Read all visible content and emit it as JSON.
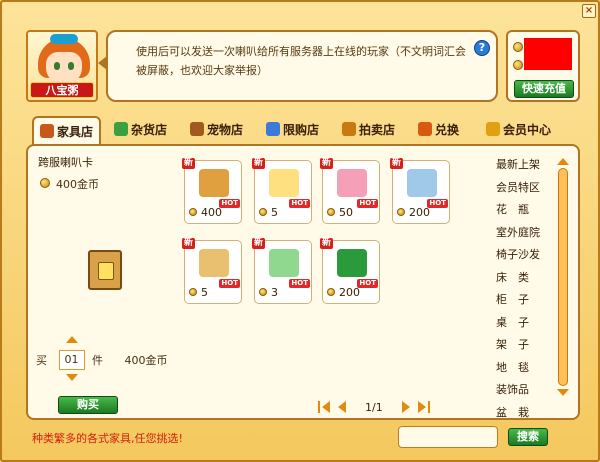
{
  "npc": {
    "name": "八宝粥",
    "message": "使用后可以发送一次喇叭给所有服务器上在线的玩家（不文明词汇会被屏蔽，也欢迎大家举报）"
  },
  "currency": {
    "recharge_label": "快速充值"
  },
  "tabs": [
    {
      "label": "家具店",
      "icon": "house-icon",
      "color": "#c8581a"
    },
    {
      "label": "杂货店",
      "icon": "clover-icon",
      "color": "#3aa040"
    },
    {
      "label": "宠物店",
      "icon": "pet-icon",
      "color": "#a05a20"
    },
    {
      "label": "限购店",
      "icon": "bottle-icon",
      "color": "#3a7ad8"
    },
    {
      "label": "拍卖店",
      "icon": "gavel-icon",
      "color": "#c87a10"
    },
    {
      "label": "兑换",
      "icon": "exchange-icon",
      "color": "#d85a10"
    },
    {
      "label": "会员中心",
      "icon": "crown-icon",
      "color": "#e0a010"
    }
  ],
  "selected_item": {
    "name": "跨服喇叭卡",
    "price": "400金币",
    "quantity_label": "买",
    "quantity": "01",
    "unit": "件",
    "total": "400金币",
    "buy_label": "购买"
  },
  "items": [
    {
      "name": "speaker-card",
      "price": "400",
      "new_badge": "新",
      "hot_badge": "HOT",
      "color": "#e0a040"
    },
    {
      "name": "wings",
      "price": "5",
      "new_badge": "新",
      "hot_badge": "HOT",
      "color": "#ffe080"
    },
    {
      "name": "pink-oven",
      "price": "50",
      "new_badge": "新",
      "hot_badge": "HOT",
      "color": "#f5a0b8"
    },
    {
      "name": "id-card",
      "price": "200",
      "new_badge": "新",
      "hot_badge": "HOT",
      "color": "#a0c8e8"
    },
    {
      "name": "magnifier",
      "price": "5",
      "new_badge": "新",
      "hot_badge": "HOT",
      "color": "#e8c070"
    },
    {
      "name": "potion-tube",
      "price": "3",
      "new_badge": "新",
      "hot_badge": "HOT",
      "color": "#90d890"
    },
    {
      "name": "green-flower",
      "price": "200",
      "new_badge": "新",
      "hot_badge": "HOT",
      "color": "#2a9a3a"
    }
  ],
  "categories": [
    "最新上架",
    "会员特区",
    "花　瓶",
    "室外庭院",
    "椅子沙发",
    "床　类",
    "柜　子",
    "桌　子",
    "架　子",
    "地　毯",
    "装饰品",
    "盆　栽"
  ],
  "pager": {
    "page": "1/1"
  },
  "footer": {
    "tip": "种类繁多的各式家具,任您挑选!",
    "search_label": "搜索"
  }
}
